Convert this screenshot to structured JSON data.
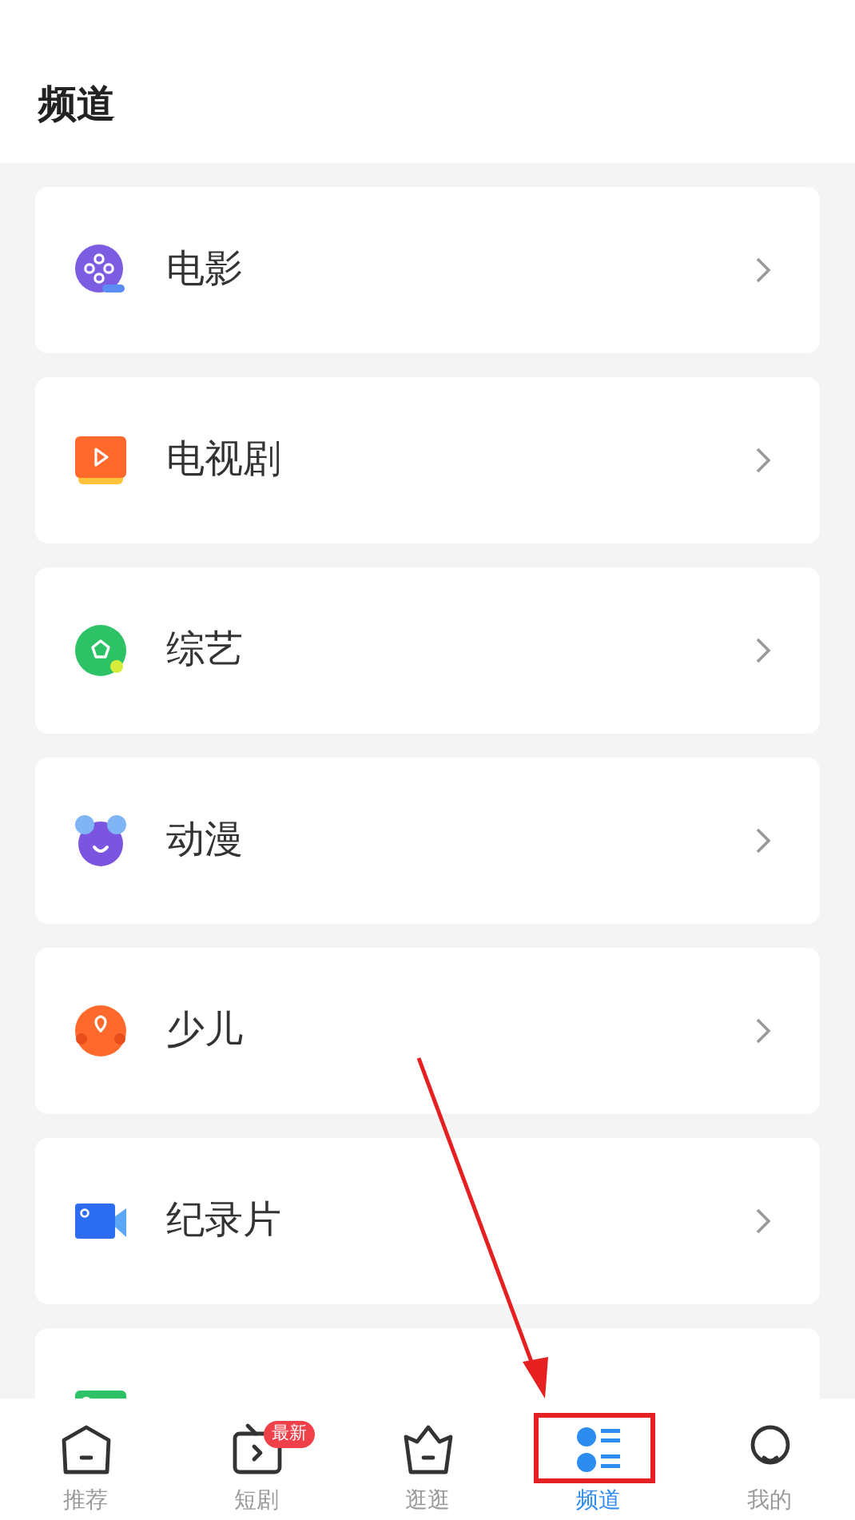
{
  "header": {
    "title": "频道"
  },
  "channels": [
    {
      "name": "电影",
      "kind": "movie"
    },
    {
      "name": "电视剧",
      "kind": "tv"
    },
    {
      "name": "综艺",
      "kind": "variety"
    },
    {
      "name": "动漫",
      "kind": "anime"
    },
    {
      "name": "少儿",
      "kind": "kids"
    },
    {
      "name": "纪录片",
      "kind": "documentary"
    },
    {
      "kind": "topic"
    }
  ],
  "tab_bar": [
    {
      "label": "推荐",
      "kind": "home",
      "selected": false
    },
    {
      "label": "短剧",
      "kind": "shorts",
      "selected": false,
      "badge": "最新"
    },
    {
      "label": "逛逛",
      "kind": "browse",
      "selected": false
    },
    {
      "label": "频道",
      "kind": "channel",
      "selected": true
    },
    {
      "label": "我的",
      "kind": "me",
      "selected": false
    }
  ]
}
